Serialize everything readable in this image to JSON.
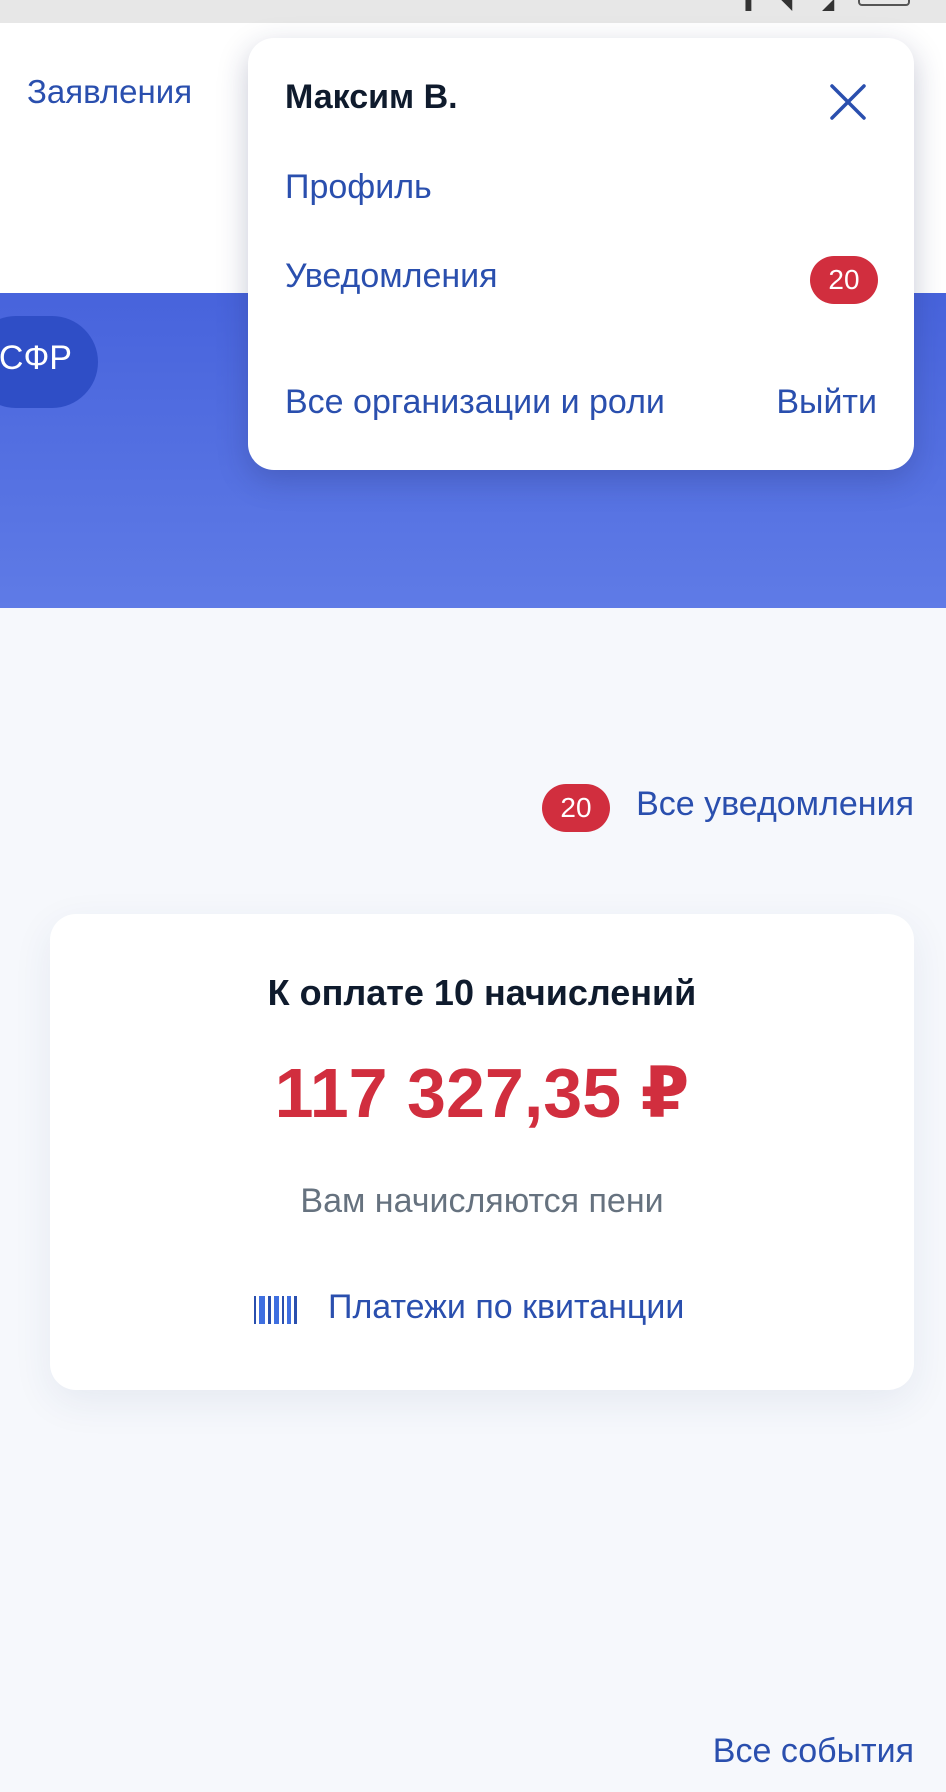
{
  "nav": {
    "applications_label": "Заявления"
  },
  "hero": {
    "chip_label": "СФР"
  },
  "popover": {
    "user_name": "Максим В.",
    "profile_label": "Профиль",
    "notifications_label": "Уведомления",
    "notifications_count": "20",
    "orgs_label": "Все организации и роли",
    "logout_label": "Выйти",
    "close_icon": "close-icon"
  },
  "notifications_link": {
    "count": "20",
    "label": "Все уведомления"
  },
  "payment_card": {
    "title": "К оплате 10 начислений",
    "amount": "117 327,35 ₽",
    "note": "Вам начисляются пени",
    "receipt_link_label": "Платежи по квитанции",
    "receipt_icon": "barcode-icon"
  },
  "footer": {
    "all_events_label": "Все события"
  },
  "colors": {
    "accent_blue": "#2a4fae",
    "hero_blue": "#3e5ad8",
    "badge_red": "#d12e3e",
    "amount_red": "#d12e3e",
    "background": "#f6f8fc"
  }
}
